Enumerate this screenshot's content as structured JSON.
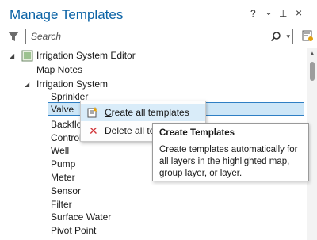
{
  "window": {
    "title": "Manage Templates",
    "help": "?",
    "menu": "⌄",
    "pin": "⊥",
    "close": "×"
  },
  "search": {
    "placeholder": "Search"
  },
  "tree": {
    "root_label": "Irrigation System Editor",
    "map_notes": "Map Notes",
    "group_label": "Irrigation System",
    "items": [
      "Sprinkler",
      "Valve",
      "Backflow",
      "Control",
      "Well",
      "Pump",
      "Meter",
      "Sensor",
      "Filter",
      "Surface Water",
      "Pivot Point"
    ]
  },
  "context_menu": {
    "create_prefix": "C",
    "create_rest": "reate all templates",
    "delete_prefix": "D",
    "delete_rest": "elete all ter"
  },
  "tooltip": {
    "title": "Create Templates",
    "body": "Create templates automatically for all layers in the highlighted map, group layer, or layer."
  },
  "colors": {
    "accent": "#0b63a6",
    "selection": "#cde6f7",
    "delete_red": "#d13438"
  }
}
